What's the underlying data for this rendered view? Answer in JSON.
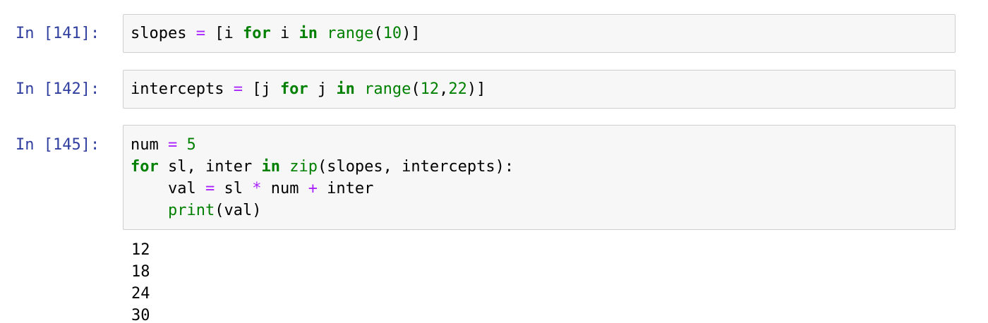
{
  "cells": [
    {
      "prompt": "In [141]:",
      "lines": [
        [
          {
            "t": "slopes ",
            "c": "plain"
          },
          {
            "t": "=",
            "c": "op"
          },
          {
            "t": " [i ",
            "c": "plain"
          },
          {
            "t": "for",
            "c": "kw"
          },
          {
            "t": " i ",
            "c": "plain"
          },
          {
            "t": "in",
            "c": "kw"
          },
          {
            "t": " ",
            "c": "plain"
          },
          {
            "t": "range",
            "c": "bi"
          },
          {
            "t": "(",
            "c": "plain"
          },
          {
            "t": "10",
            "c": "num"
          },
          {
            "t": ")]",
            "c": "plain"
          }
        ]
      ]
    },
    {
      "prompt": "In [142]:",
      "lines": [
        [
          {
            "t": "intercepts ",
            "c": "plain"
          },
          {
            "t": "=",
            "c": "op"
          },
          {
            "t": " [j ",
            "c": "plain"
          },
          {
            "t": "for",
            "c": "kw"
          },
          {
            "t": " j ",
            "c": "plain"
          },
          {
            "t": "in",
            "c": "kw"
          },
          {
            "t": " ",
            "c": "plain"
          },
          {
            "t": "range",
            "c": "bi"
          },
          {
            "t": "(",
            "c": "plain"
          },
          {
            "t": "12",
            "c": "num"
          },
          {
            "t": ",",
            "c": "plain"
          },
          {
            "t": "22",
            "c": "num"
          },
          {
            "t": ")]",
            "c": "plain"
          }
        ]
      ]
    },
    {
      "prompt": "In [145]:",
      "lines": [
        [
          {
            "t": "num ",
            "c": "plain"
          },
          {
            "t": "=",
            "c": "op"
          },
          {
            "t": " ",
            "c": "plain"
          },
          {
            "t": "5",
            "c": "num"
          }
        ],
        [
          {
            "t": "for",
            "c": "kw"
          },
          {
            "t": " sl, inter ",
            "c": "plain"
          },
          {
            "t": "in",
            "c": "kw"
          },
          {
            "t": " ",
            "c": "plain"
          },
          {
            "t": "zip",
            "c": "bi"
          },
          {
            "t": "(slopes, intercepts):",
            "c": "plain"
          }
        ],
        [
          {
            "t": "    val ",
            "c": "plain"
          },
          {
            "t": "=",
            "c": "op"
          },
          {
            "t": " sl ",
            "c": "plain"
          },
          {
            "t": "*",
            "c": "op"
          },
          {
            "t": " num ",
            "c": "plain"
          },
          {
            "t": "+",
            "c": "op"
          },
          {
            "t": " inter",
            "c": "plain"
          }
        ],
        [
          {
            "t": "    ",
            "c": "plain"
          },
          {
            "t": "print",
            "c": "bi"
          },
          {
            "t": "(val)",
            "c": "plain"
          }
        ]
      ],
      "output": [
        "12",
        "18",
        "24",
        "30"
      ]
    }
  ]
}
